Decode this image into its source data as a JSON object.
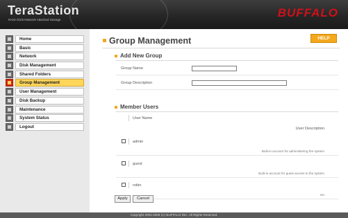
{
  "header": {
    "brand": "TeraStation",
    "subtitle": "RAID 0/1/5 Network Attached Storage",
    "logo": "BUFFALO"
  },
  "sidebar": {
    "items": [
      {
        "label": "Home",
        "icon": "home-icon"
      },
      {
        "label": "Basic",
        "icon": "basic-icon"
      },
      {
        "label": "Network",
        "icon": "network-icon"
      },
      {
        "label": "Disk Management",
        "icon": "disk-icon"
      },
      {
        "label": "Shared Folders",
        "icon": "folder-icon"
      },
      {
        "label": "Group Management",
        "icon": "group-icon",
        "active": true
      },
      {
        "label": "User Management",
        "icon": "user-icon"
      },
      {
        "label": "Disk Backup",
        "icon": "backup-icon"
      },
      {
        "label": "Maintenance",
        "icon": "maintenance-icon"
      },
      {
        "label": "System Status",
        "icon": "status-icon"
      },
      {
        "label": "Logout",
        "icon": "logout-icon"
      }
    ]
  },
  "main": {
    "title": "Group Management",
    "help_label": "HELP",
    "add_group": {
      "title": "Add New Group",
      "name_label": "Group Name",
      "name_value": "",
      "description_label": "Group Description",
      "description_value": ""
    },
    "members": {
      "title": "Member Users",
      "col_user": "User Name",
      "col_description": "User Description",
      "users": [
        {
          "name": "admin",
          "description": "Built-in account for administering the system",
          "checked": false
        },
        {
          "name": "guest",
          "description": "Built-in account for guest access to the system",
          "checked": false
        },
        {
          "name": "robin",
          "description": "me",
          "checked": false
        }
      ]
    },
    "apply_label": "Apply",
    "cancel_label": "Cancel"
  },
  "footer": {
    "text": "Copyright 2002-2006 (C) BUFFALO INC. All Rights Reserved."
  },
  "colors": {
    "header": "#262626",
    "accent": "#f2a51a",
    "active_nav": "#ffd65a",
    "logo": "#d0101a"
  }
}
